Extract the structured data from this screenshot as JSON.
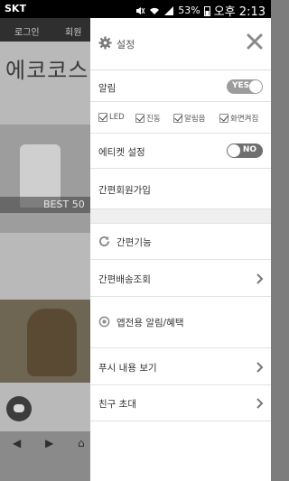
{
  "statusbar": {
    "carrier": "SKT",
    "battery": "53%",
    "time": "오후 2:13"
  },
  "background": {
    "nav_items": [
      "로그인",
      "회원"
    ],
    "logo_text": "에코코스메",
    "best_label": "BEST 50"
  },
  "drawer": {
    "title": "설정",
    "notification_label": "알림",
    "notification_toggle": "YES",
    "checkboxes": [
      "LED",
      "진동",
      "알림음",
      "화면켜짐"
    ],
    "etiquette_label": "에티켓 설정",
    "etiquette_toggle": "NO",
    "simple_join": "간편회원가입",
    "simple_function": "간편기능",
    "delivery_lookup": "간편배송조회",
    "app_notice": "앱전용 알림/혜택",
    "push_view": "푸시 내용 보기",
    "invite_friends": "친구 초대"
  },
  "colors": {
    "drawer_bg": "#ffffff",
    "toggle_yes": "#9c9c9c",
    "toggle_no": "#6f6f6f"
  }
}
